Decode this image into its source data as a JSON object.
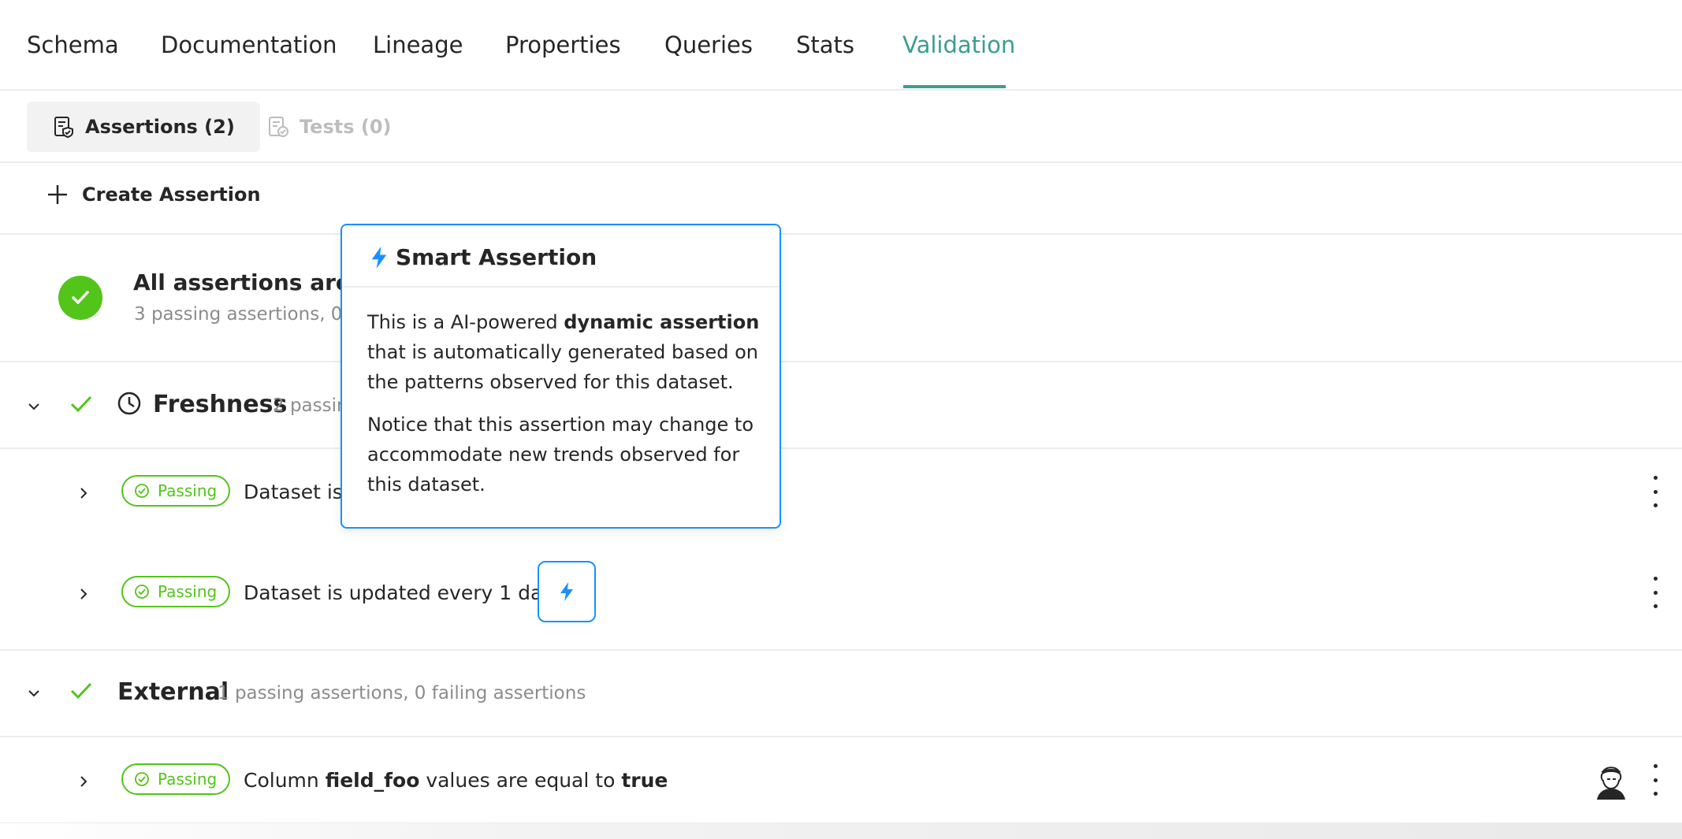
{
  "tabs": [
    "Schema",
    "Documentation",
    "Lineage",
    "Properties",
    "Queries",
    "Stats",
    "Validation"
  ],
  "active_tab": "Validation",
  "subtabs": {
    "assertions": "Assertions (2)",
    "tests": "Tests (0)"
  },
  "create_label": "Create Assertion",
  "summary": {
    "title": "All assertions are pa",
    "subtitle": "3 passing assertions, 0"
  },
  "groups": {
    "freshness": {
      "title": "Freshness",
      "subtitle": "2 passin"
    },
    "external": {
      "title": "External",
      "subtitle": "1 passing assertions, 0 failing assertions"
    }
  },
  "rows": [
    {
      "status": "Passing",
      "text": "Dataset is u"
    },
    {
      "status": "Passing",
      "text": "Dataset is updated every 1 days"
    },
    {
      "status": "Passing",
      "prefix": "Column ",
      "field": "field_foo",
      "middle": " values are equal to ",
      "value": "true"
    }
  ],
  "popover": {
    "title": "Smart Assertion",
    "p1_a": "This is a AI-powered ",
    "p1_bold": "dynamic assertion",
    "p1_b": " that is automatically generated based on the patterns observed for this dataset.",
    "p2": "Notice that this assertion may change to accommodate new trends observed for this dataset."
  },
  "colors": {
    "accent": "#3a9d92",
    "success": "#52c41a",
    "info": "#1890ff"
  },
  "icons": [
    "assertion-doc-icon",
    "test-doc-icon",
    "plus-icon",
    "check-circle-icon",
    "chevron-down-icon",
    "check-icon",
    "clock-icon",
    "chevron-right-icon",
    "bolt-icon",
    "more-vertical-icon",
    "avatar-icon"
  ]
}
